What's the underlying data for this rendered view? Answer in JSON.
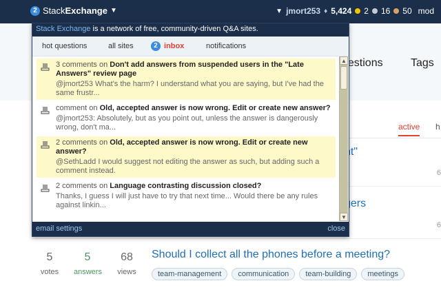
{
  "topbar": {
    "inbox_count": "2",
    "brand_light": "Stack",
    "brand_bold": "Exchange",
    "username": "jmort253",
    "reputation": "5,424",
    "gold": "2",
    "silver": "16",
    "bronze": "50",
    "role": "mod"
  },
  "dropdown": {
    "intro_link": "Stack Exchange",
    "intro_text": " is a network of free, community-driven Q&A sites.",
    "tabs": [
      "hot questions",
      "all sites",
      "inbox",
      "notifications"
    ],
    "inbox_badge": "2",
    "items": [
      {
        "kind": "3 comments on",
        "title": "Don't add answers from suspended users in the \"Late Answers\" review page",
        "excerpt": "@jmort253 What's the harm? I understand what you are saying, but I've had the same frustr...",
        "unread": true
      },
      {
        "kind": "comment on",
        "title": "Old, accepted answer is now wrong. Edit or create new answer?",
        "excerpt": "@jmort253: Absolutely, but as you point out, unless the answer is dangerously wrong, don't ma...",
        "unread": false
      },
      {
        "kind": "2 comments on",
        "title": "Old, accepted answer is now wrong. Edit or create new answer?",
        "excerpt": "@SethLadd I would suggest not editing the answer as such, but adding such a comment instead.",
        "unread": true
      },
      {
        "kind": "2 comments on",
        "title": "Language contrasting discussion closed?",
        "excerpt": "Thanks, I guess I will just have to try that next time... Would there be any rules against linkin...",
        "unread": false
      }
    ],
    "footer_left": "email settings",
    "footer_right": "close"
  },
  "background": {
    "nav_questions": "uestions",
    "nav_tags": "Tags",
    "tab_active": "active",
    "tab_next": "h",
    "title_fragment_1": "ht\"",
    "title_fragment_2": "gers",
    "side_num_1": "6",
    "side_num_2": "6",
    "question": {
      "votes": "5",
      "votes_label": "votes",
      "answers": "5",
      "answers_label": "answers",
      "views": "68",
      "views_label": "views",
      "title": "Should I collect all the phones before a meeting?",
      "tags": [
        "team-management",
        "communication",
        "team-building",
        "meetings"
      ]
    }
  }
}
